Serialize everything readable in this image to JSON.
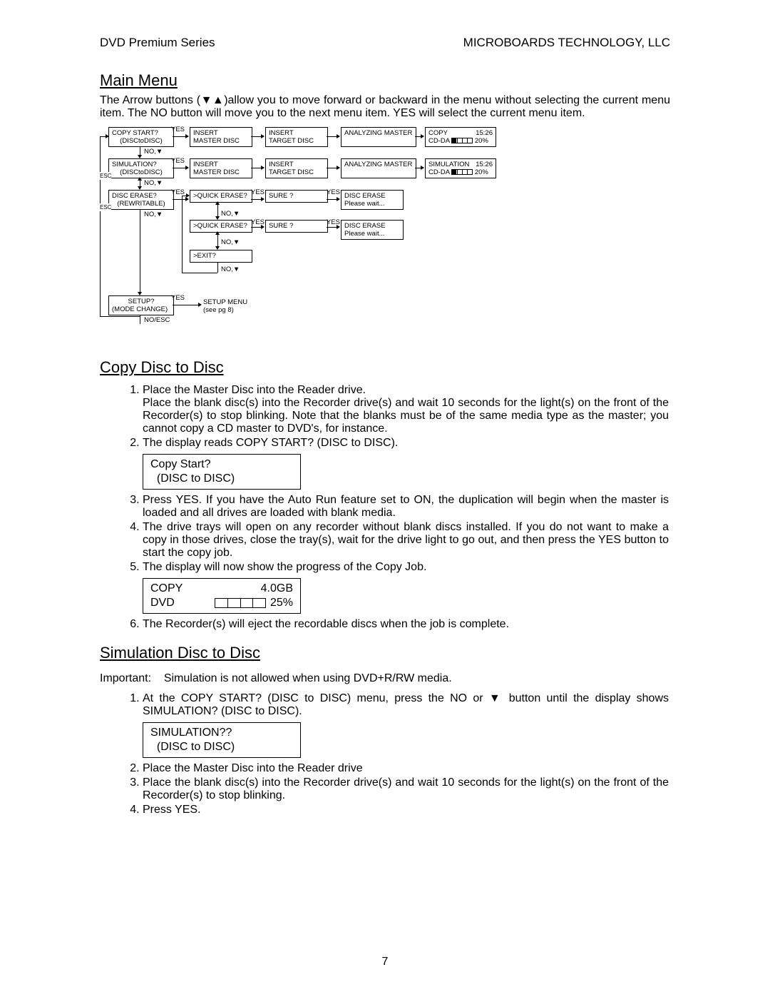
{
  "header": {
    "left": "DVD Premium Series",
    "right": "MICROBOARDS TECHNOLOGY, LLC"
  },
  "main_menu": {
    "title": "Main Menu",
    "intro": "The Arrow buttons (▼▲)allow you to move forward or backward in the menu without selecting the current menu item.  The NO button will move you to the next menu item.  YES will select the current menu item."
  },
  "diagram": {
    "row1": {
      "b1a": "COPY START?",
      "b1b": "(DISCtoDISC)",
      "yes": "YES",
      "b2a": "INSERT",
      "b2b": "MASTER DISC",
      "b3a": "INSERT",
      "b3b": "TARGET DISC",
      "b4": "ANALYZING MASTER",
      "b5a": "COPY",
      "b5t": "15:26",
      "b5b": "CD-DA",
      "b5p": "20%",
      "no": "NO,▼"
    },
    "row2": {
      "b1a": "SIMULATION?",
      "b1b": "(DISCtoDISC)",
      "yes": "YES",
      "b2a": "INSERT",
      "b2b": "MASTER DISC",
      "b3a": "INSERT",
      "b3b": "TARGET DISC",
      "b4": "ANALYZING MASTER",
      "b5a": "SIMULATION",
      "b5t": "15:26",
      "b5b": "CD-DA",
      "b5p": "20%",
      "esc": "ESC",
      "no": "NO,▼"
    },
    "row3": {
      "b1a": "DISC ERASE?",
      "b1b": "(REWRITABLE)",
      "yes": "YES",
      "b2": ">QUICK ERASE?",
      "yes2": "YES",
      "b3": "SURE ?",
      "yes3": "YES",
      "b4a": "DISC ERASE",
      "b4b": "Please wait...",
      "esc": "ESC",
      "no": "NO,▼"
    },
    "row4": {
      "b2": ">QUICK ERASE?",
      "yes2": "YES",
      "b3": "SURE ?",
      "yes3": "YES",
      "b4a": "DISC ERASE",
      "b4b": "Please wait...",
      "no": "NO,▼"
    },
    "row5": {
      "b2": ">EXIT?",
      "no": "NO,▼"
    },
    "row6": {
      "b1a": "SETUP?",
      "b1b": "(MODE CHANGE)",
      "yes": "YES",
      "b2a": "SETUP MENU",
      "b2b": "(see pg 8)",
      "no": "NO/ESC"
    }
  },
  "copy_section": {
    "title": "Copy Disc to Disc",
    "step1": "Place the Master Disc into the Reader drive.",
    "step1b": "Place the blank disc(s) into the Recorder drive(s) and wait 10 seconds for the light(s) on the front of the Recorder(s) to stop blinking.  Note that the blanks must be of the same media type as the master; you cannot copy a CD master to DVD's, for instance.",
    "step2": "The display reads COPY START? (DISC to DISC).",
    "display1a": "Copy Start?",
    "display1b": "(DISC to DISC)",
    "step3": "Press YES.  If you have the Auto Run feature set to ON, the duplication will begin when the master is loaded and all drives are loaded with blank media.",
    "step4": "The drive trays will open on any recorder without blank discs installed.  If you do not want to make a copy in those drives, close the tray(s), wait for the drive light to go out, and then press the YES button to start the copy job.",
    "step5": "The display will now show the progress of the Copy Job.",
    "display2_copy": "COPY",
    "display2_size": "4.0GB",
    "display2_dvd": "DVD",
    "display2_pct": "25%",
    "step6": "The Recorder(s) will eject the recordable discs when the job is complete."
  },
  "sim_section": {
    "title": "Simulation Disc to Disc",
    "important_label": "Important:",
    "important_text": "Simulation is not allowed when using DVD+R/RW media.",
    "step1": "At the COPY START? (DISC to DISC) menu, press the NO or ▼ button until the display shows SIMULATION? (DISC to DISC).",
    "display1a": "SIMULATION??",
    "display1b": "(DISC to DISC)",
    "step2": "Place the Master Disc into the Reader drive",
    "step3": "Place the blank disc(s) into the Recorder drive(s) and wait 10 seconds for the light(s) on the front of the Recorder(s) to stop blinking.",
    "step4": "Press YES."
  },
  "page_number": "7"
}
